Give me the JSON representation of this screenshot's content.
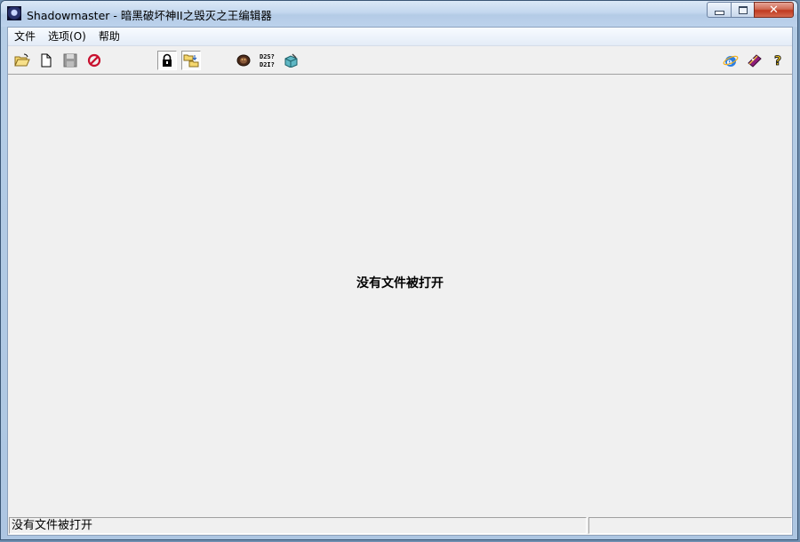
{
  "window": {
    "title": "Shadowmaster - 暗黑破坏神II之毁灭之王编辑器",
    "minimize_glyph": "",
    "close_glyph": "✕"
  },
  "menu": {
    "items": [
      {
        "label": "文件"
      },
      {
        "label": "选项(O)"
      },
      {
        "label": "帮助"
      }
    ]
  },
  "toolbar": {
    "buttons": [
      {
        "icon": "open-folder-icon"
      },
      {
        "icon": "new-file-icon"
      },
      {
        "icon": "save-disk-icon",
        "disabled": true
      },
      {
        "icon": "stop-icon"
      },
      {
        "icon": "lock-icon",
        "pressed": true
      },
      {
        "icon": "transfer-folder-icon",
        "pressed": true
      },
      {
        "icon": "character-portrait-icon"
      },
      {
        "icon": "d2-query-icon",
        "text_top": "D2S?",
        "text_bottom": "D2I?"
      },
      {
        "icon": "diagnostic-box-icon"
      },
      {
        "icon": "internet-explorer-icon"
      },
      {
        "icon": "help-book-icon"
      },
      {
        "icon": "question-help-icon"
      }
    ]
  },
  "main": {
    "message": "没有文件被打开"
  },
  "status": {
    "text": "没有文件被打开",
    "right_pane": ""
  }
}
